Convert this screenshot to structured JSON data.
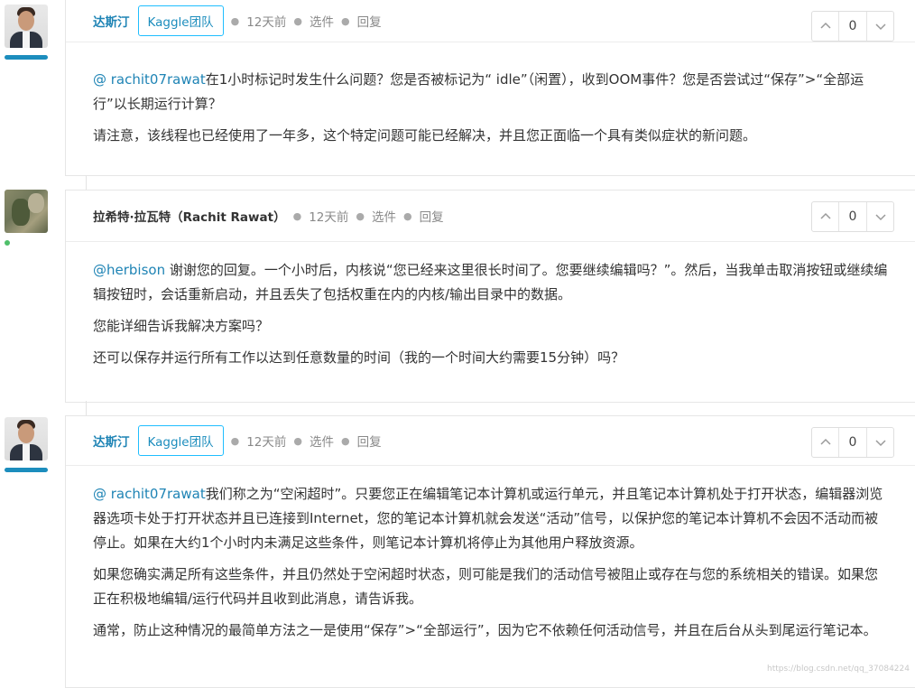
{
  "comments": [
    {
      "author": "达斯汀",
      "badge": "Kaggle团队",
      "time": "12天前",
      "select": "选件",
      "reply": "回复",
      "votes": "0",
      "paragraphs": [
        {
          "mention": "@ rachit07rawat",
          "text": "在1小时标记时发生什么问题？您是否被标记为“ idle”（闲置），收到OOM事件？您是否尝试过“保存”>“全部运行”以长期运行计算？"
        },
        {
          "mention": "",
          "text": "请注意，该线程也已经使用了一年多，这个特定问题可能已经解决，并且您正面临一个具有类似症状的新问题。"
        }
      ]
    },
    {
      "author": "拉希特·拉瓦特（Rachit Rawat）",
      "badge": "",
      "time": "12天前",
      "select": "选件",
      "reply": "回复",
      "votes": "0",
      "paragraphs": [
        {
          "mention": "@herbison",
          "text": " 谢谢您的回复。一个小时后，内核说“您已经来这里很长时间了。您要继续编辑吗？”。然后，当我单击取消按钮或继续编辑按钮时，会话重新启动，并且丢失了包括权重在内的内核/输出目录中的数据。"
        },
        {
          "mention": "",
          "text": "您能详细告诉我解决方案吗？"
        },
        {
          "mention": "",
          "text": "还可以保存并运行所有工作以达到任意数量的时间（我的一个时间大约需要15分钟）吗？"
        }
      ]
    },
    {
      "author": "达斯汀",
      "badge": "Kaggle团队",
      "time": "12天前",
      "select": "选件",
      "reply": "回复",
      "votes": "0",
      "paragraphs": [
        {
          "mention": "@ rachit07rawat",
          "text": "我们称之为“空闲超时”。只要您正在编辑笔记本计算机或运行单元，并且笔记本计算机处于打开状态，编辑器浏览器选项卡处于打开状态并且已连接到Internet，您的笔记本计算机就会发送“活动”信号，以保护您的笔记本计算机不会因不活动而被停止。如果在大约1个小时内未满足这些条件，则笔记本计算机将停止为其他用户释放资源。"
        },
        {
          "mention": "",
          "text": "如果您确实满足所有这些条件，并且仍然处于空闲超时状态，则可能是我们的活动信号被阻止或存在与您的系统相关的错误。如果您正在积极地编辑/运行代码并且收到此消息，请告诉我。"
        },
        {
          "mention": "",
          "text": "通常，防止这种情况的最简单方法之一是使用“保存”>“全部运行”，因为它不依赖任何活动信号，并且在后台从头到尾运行笔记本。"
        }
      ]
    }
  ],
  "watermark": "https://blog.csdn.net/qq_37084224"
}
